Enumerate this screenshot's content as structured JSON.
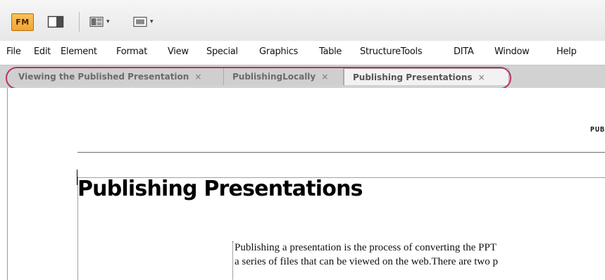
{
  "toolbar": {
    "logo_text": "FM",
    "icons": [
      "app-logo-icon",
      "panel-toggle-icon",
      "layout-menu-icon",
      "screen-mode-icon"
    ],
    "dropdown_glyph": "▾"
  },
  "menubar": {
    "items": [
      "File",
      "Edit",
      "Element",
      "Format",
      "View",
      "Special",
      "Graphics",
      "Table",
      "StructureTools",
      "DITA",
      "Window",
      "Help"
    ]
  },
  "tabs": [
    {
      "label": "Viewing the Published Presentation",
      "active": false
    },
    {
      "label": "PublishingLocally",
      "active": false
    },
    {
      "label": "Publishing Presentations",
      "active": true
    }
  ],
  "tab_close_glyph": "×",
  "document": {
    "running_header": "PUB",
    "title": "Publishing Presentations",
    "body_lines": [
      "Publishing a presentation is the process of converting the PPT",
      "a series of files that can be viewed on the web.There are two p"
    ]
  },
  "colors": {
    "highlight_ring": "#b8316b",
    "logo_fill": "#f2a531"
  }
}
